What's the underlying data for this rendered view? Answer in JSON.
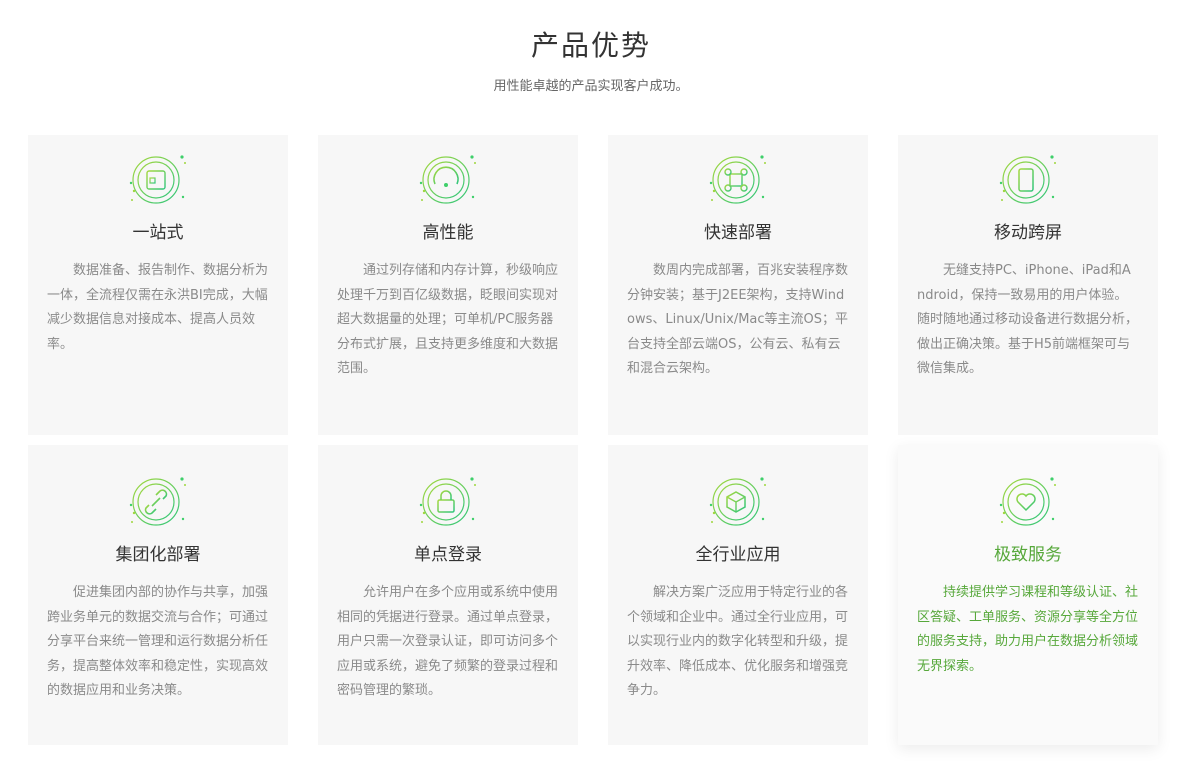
{
  "header": {
    "title": "产品优势",
    "subtitle": "用性能卓越的产品实现客户成功。"
  },
  "colors": {
    "accent": "#3fcf6a",
    "highlight_text": "#57a83b",
    "card_bg": "#f7f7f7"
  },
  "cards": [
    {
      "icon": "dashboard-icon",
      "title": "一站式",
      "desc": "数据准备、报告制作、数据分析为一体，全流程仅需在永洪BI完成，大幅减少数据信息对接成本、提高人员效率。"
    },
    {
      "icon": "speedometer-icon",
      "title": "高性能",
      "desc": "通过列存储和内存计算，秒级响应处理千万到百亿级数据，眨眼间实现对超大数据量的处理；可单机/PC服务器分布式扩展，且支持更多维度和大数据范围。"
    },
    {
      "icon": "network-nodes-icon",
      "title": "快速部署",
      "desc": "数周内完成部署，百兆安装程序数分钟安装；基于J2EE架构，支持Windows、Linux/Unix/Mac等主流OS；平台支持全部云端OS，公有云、私有云和混合云架构。"
    },
    {
      "icon": "mobile-icon",
      "title": "移动跨屏",
      "desc": "无缝支持PC、iPhone、iPad和Android，保持一致易用的用户体验。随时随地通过移动设备进行数据分析，做出正确决策。基于H5前端框架可与微信集成。"
    },
    {
      "icon": "link-icon",
      "title": "集团化部署",
      "desc": "促进集团内部的协作与共享，加强跨业务单元的数据交流与合作；可通过分享平台来统一管理和运行数据分析任务，提高整体效率和稳定性，实现高效的数据应用和业务决策。"
    },
    {
      "icon": "lock-icon",
      "title": "单点登录",
      "desc": "允许用户在多个应用或系统中使用相同的凭据进行登录。通过单点登录，用户只需一次登录认证，即可访问多个应用或系统，避免了频繁的登录过程和密码管理的繁琐。"
    },
    {
      "icon": "cube-icon",
      "title": "全行业应用",
      "desc": "解决方案广泛应用于特定行业的各个领域和企业中。通过全行业应用，可以实现行业内的数字化转型和升级，提升效率、降低成本、优化服务和增强竞争力。"
    },
    {
      "icon": "heart-icon",
      "title": "极致服务",
      "desc": "持续提供学习课程和等级认证、社区答疑、工单服务、资源分享等全方位的服务支持，助力用户在数据分析领域无界探索。"
    }
  ]
}
